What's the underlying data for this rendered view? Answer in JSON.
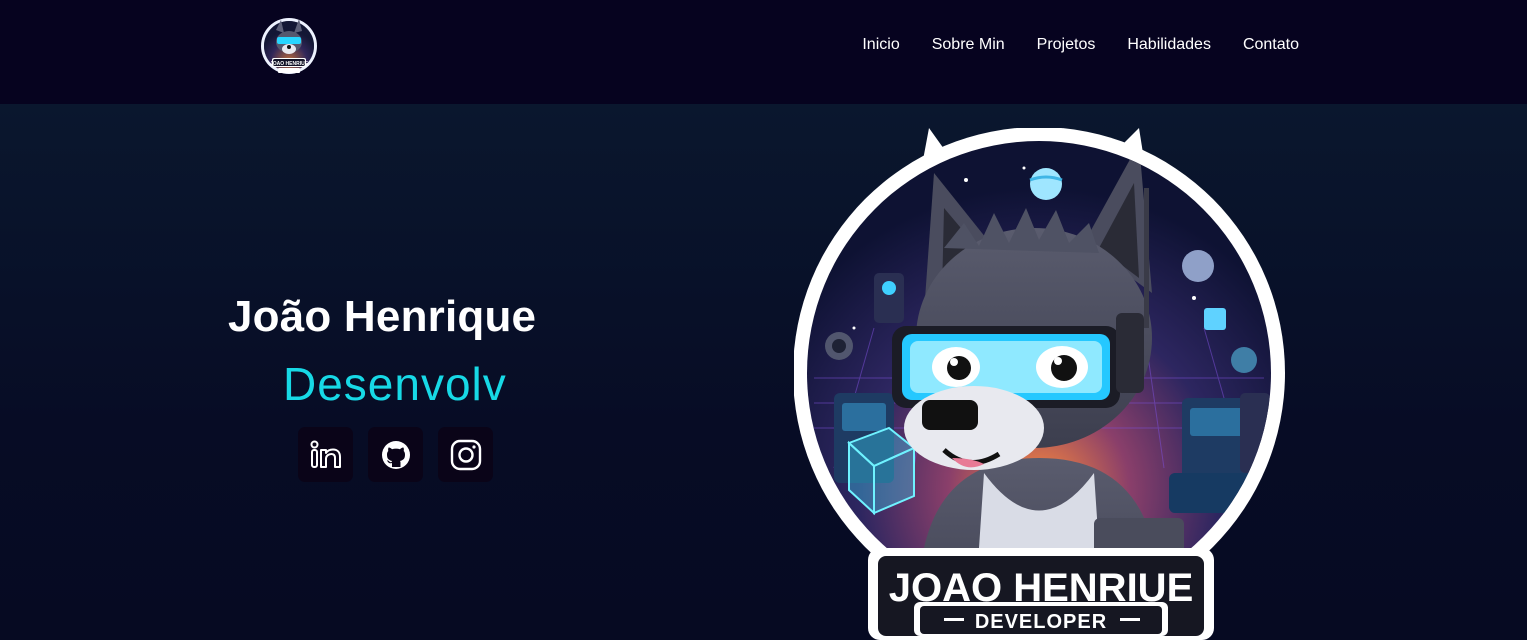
{
  "header": {
    "logo_alt": "JOAO HENRIUE",
    "nav": [
      {
        "label": "Inicio"
      },
      {
        "label": "Sobre Min"
      },
      {
        "label": "Projetos"
      },
      {
        "label": "Habilidades"
      },
      {
        "label": "Contato"
      }
    ]
  },
  "hero": {
    "name": "João Henrique",
    "role_typed": "Desenvolv",
    "socials": [
      {
        "icon": "linkedin-icon"
      },
      {
        "icon": "github-icon"
      },
      {
        "icon": "instagram-icon"
      }
    ],
    "mascot": {
      "banner_title": "JOAO HENRIUE",
      "banner_subtitle": "DEVELOPER"
    }
  },
  "colors": {
    "topbar": "#06031f",
    "background": "#070a22",
    "accent": "#17d9e6",
    "social_bg": "#0a0418"
  }
}
